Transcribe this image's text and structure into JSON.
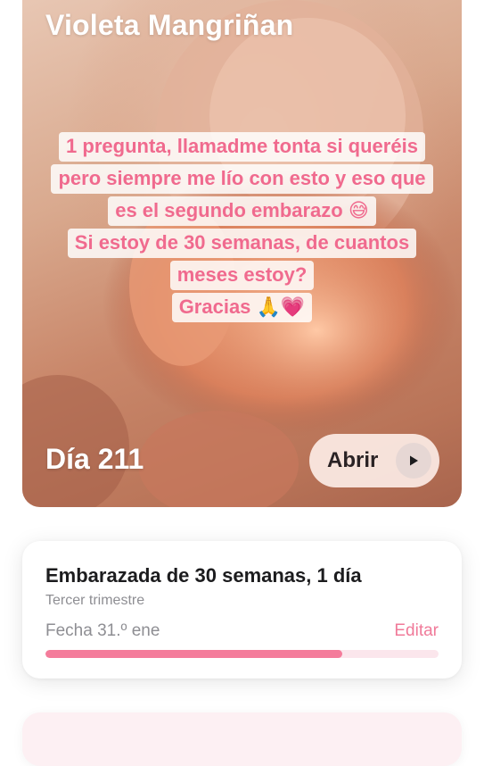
{
  "hero": {
    "name": "Violeta Mangriñan",
    "question_lines": [
      "1 pregunta, llamadme tonta si queréis",
      "pero siempre me lío con esto y eso que",
      "es el segundo embarazo 😅",
      "Si estoy de 30 semanas, de cuantos",
      "meses estoy?",
      "Gracias 🙏💗"
    ],
    "day_label": "Día 211",
    "open_button_label": "Abrir",
    "play_icon": "play-icon"
  },
  "pregnancy_card": {
    "title": "Embarazada de 30 semanas, 1 día",
    "trimester": "Tercer trimestre",
    "due_date": "Fecha 31.º ene",
    "edit_label": "Editar",
    "progress_fraction": 0.755
  },
  "colors": {
    "accent_pink": "#f47c9b",
    "question_text": "#f06a8e",
    "progress_track": "#fbe6ec"
  }
}
